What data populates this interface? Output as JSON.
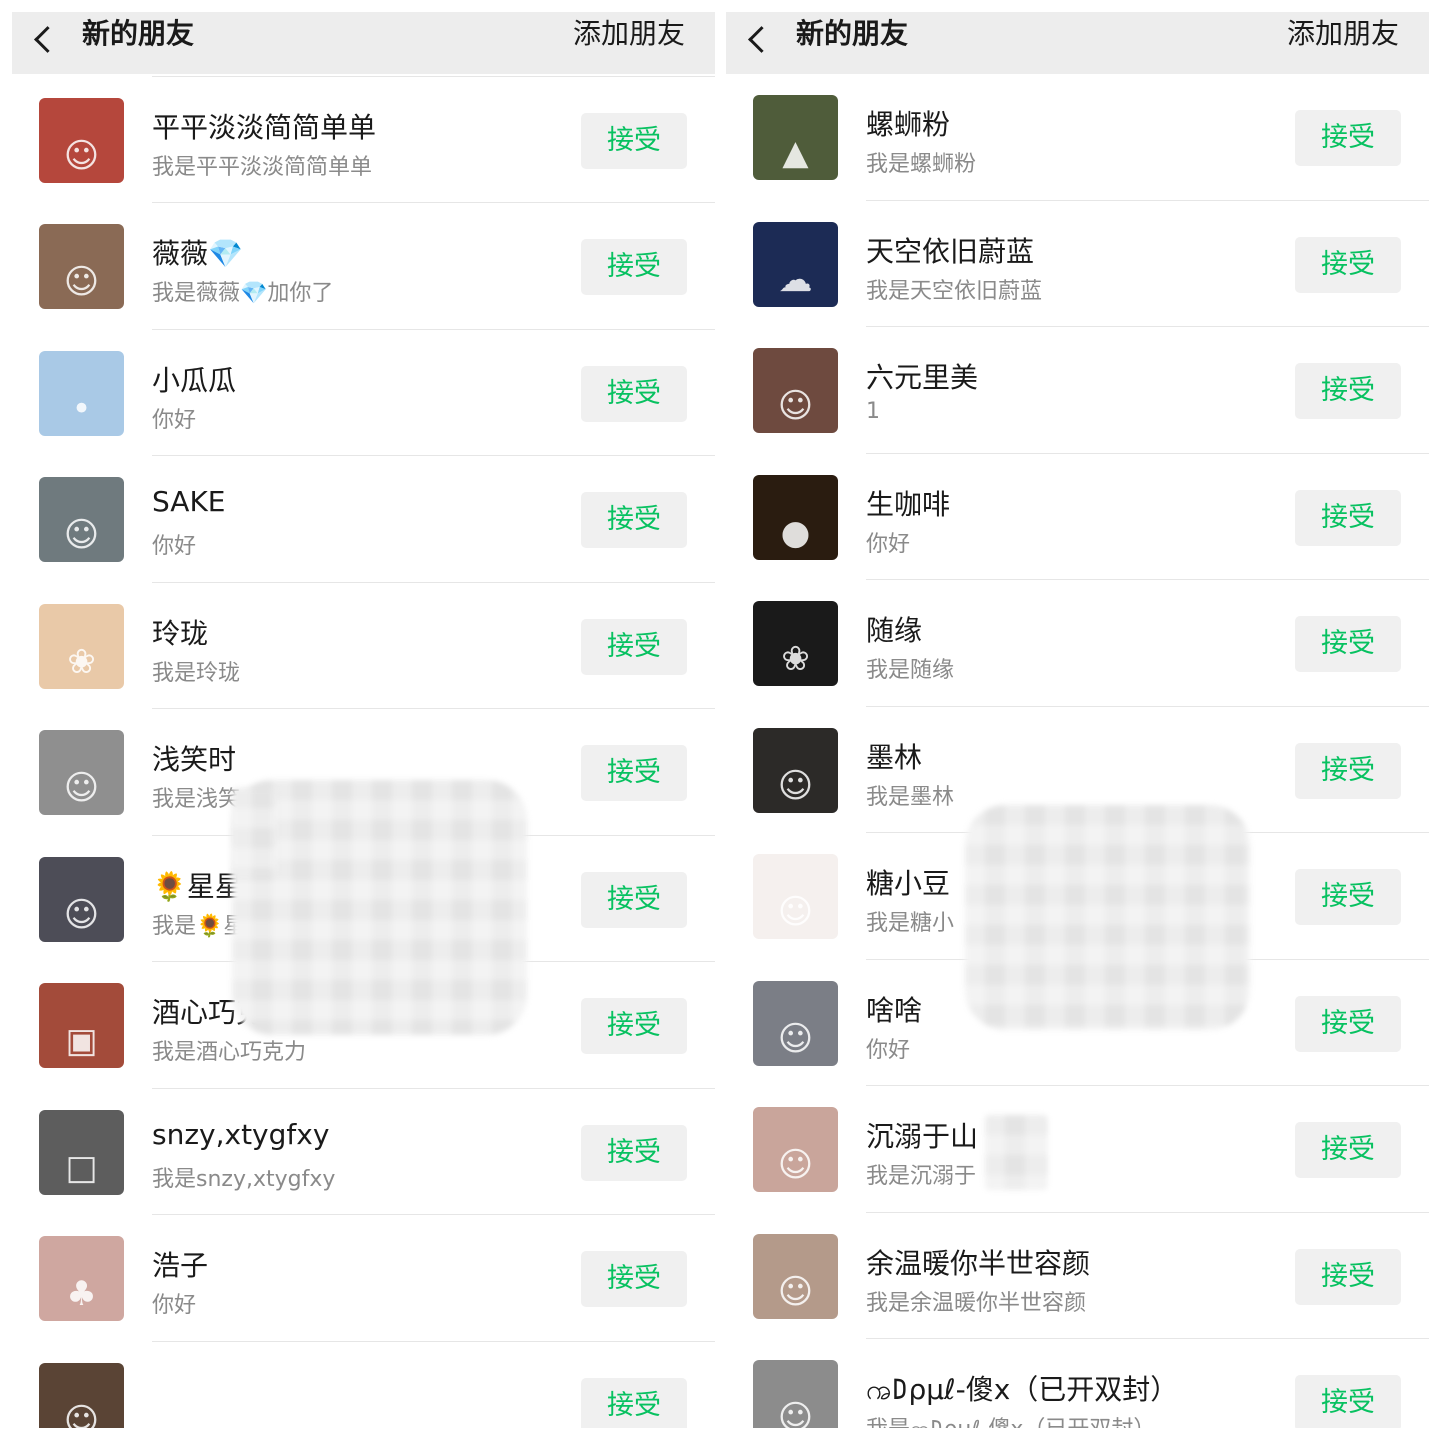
{
  "header": {
    "title": "新的朋友",
    "action": "添加朋友"
  },
  "accept_label": "接受",
  "left_list": [
    {
      "name": "",
      "message": "我是ꩠ𐌃ρμℓ-傻x（已开双封）",
      "avatar_color": "#c9c9c9",
      "avatar_icon": "person-icon"
    },
    {
      "name": "平平淡淡简简单单",
      "message": "我是平平淡淡简简单单",
      "avatar_color": "#b5473c",
      "avatar_icon": "family-icon"
    },
    {
      "name": "薇薇💎",
      "message": "我是薇薇💎加你了",
      "avatar_color": "#8a6a55",
      "avatar_icon": "person-icon"
    },
    {
      "name": "小瓜瓜",
      "message": "你好",
      "avatar_color": "#a9c9e6",
      "avatar_icon": "bicycle-icon"
    },
    {
      "name": "SAKE",
      "message": "你好",
      "avatar_color": "#6f7a7e",
      "avatar_icon": "person-icon"
    },
    {
      "name": "玲珑",
      "message": "我是玲珑",
      "avatar_color": "#e9c9a8",
      "avatar_icon": "monkey-icon"
    },
    {
      "name": "浅笑时",
      "message": "我是浅笑",
      "avatar_color": "#8f8f8f",
      "avatar_icon": "person-icon"
    },
    {
      "name": "🌻星星",
      "message": "我是🌻星",
      "avatar_color": "#4d4d57",
      "avatar_icon": "person-icon"
    },
    {
      "name": "酒心巧克力",
      "message": "我是酒心巧克力",
      "avatar_color": "#a34b3a",
      "avatar_icon": "building-icon"
    },
    {
      "name": "snzy,xtygfxy",
      "message": "我是snzy,xtygfxy",
      "avatar_color": "#5d5d5d",
      "avatar_icon": "photo-icon"
    },
    {
      "name": "浩子",
      "message": "你好",
      "avatar_color": "#cfa7a0",
      "avatar_icon": "tree-icon"
    },
    {
      "name": "",
      "message": "",
      "avatar_color": "#5a4435",
      "avatar_icon": "person-icon"
    }
  ],
  "right_list": [
    {
      "name": "螺蛳粉",
      "message": "我是螺蛳粉",
      "avatar_color": "#4f5c3a",
      "avatar_icon": "landscape-icon"
    },
    {
      "name": "天空依旧蔚蓝",
      "message": "我是天空依旧蔚蓝",
      "avatar_color": "#1c2b55",
      "avatar_icon": "sky-icon"
    },
    {
      "name": "六元里美",
      "message": "1",
      "avatar_color": "#6e4a3f",
      "avatar_icon": "person-icon"
    },
    {
      "name": "生咖啡",
      "message": "你好",
      "avatar_color": "#2a1c10",
      "avatar_icon": "teapot-icon"
    },
    {
      "name": "随缘",
      "message": "我是随缘",
      "avatar_color": "#1a1a1a",
      "avatar_icon": "flower-icon"
    },
    {
      "name": "墨林",
      "message": "我是墨林",
      "avatar_color": "#2c2a28",
      "avatar_icon": "person-icon"
    },
    {
      "name": "糖小豆",
      "message": "我是糖小",
      "avatar_color": "#f5f0ee",
      "avatar_icon": "girl-cartoon-icon"
    },
    {
      "name": "啥啥",
      "message": "你好",
      "avatar_color": "#7b7e86",
      "avatar_icon": "child-icon"
    },
    {
      "name": "沉溺于山",
      "message": "我是沉溺于",
      "avatar_color": "#c9a59b",
      "avatar_icon": "person-icon"
    },
    {
      "name": "余温暖你半世容颜",
      "message": "我是余温暖你半世容颜",
      "avatar_color": "#b49a8a",
      "avatar_icon": "anime-girl-icon"
    },
    {
      "name": "ꩠ𐌃ρμℓ-傻x（已开双封）",
      "message": "我是ꩠ𐌃ρμℓ-傻x（已开双封）",
      "avatar_color": "#8c8c8c",
      "avatar_icon": "person-icon"
    }
  ]
}
